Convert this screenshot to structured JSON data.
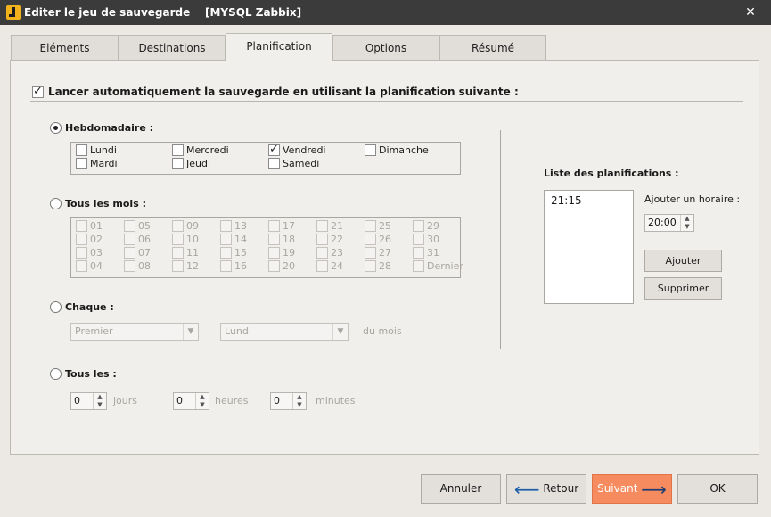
{
  "window": {
    "title": "Editer le jeu de sauvegarde    [MYSQL Zabbix]",
    "close_glyph": "✕"
  },
  "tabs": [
    {
      "label": "Eléments"
    },
    {
      "label": "Destinations"
    },
    {
      "label": "Planification"
    },
    {
      "label": "Options"
    },
    {
      "label": "Résumé"
    }
  ],
  "schedule": {
    "auto_label": "Lancer automatiquement la sauvegarde en utilisant la planification suivante :",
    "weekly": {
      "label": "Hebdomadaire :",
      "days": [
        {
          "label": "Lundi",
          "checked": false
        },
        {
          "label": "Mercredi",
          "checked": false
        },
        {
          "label": "Vendredi",
          "checked": true
        },
        {
          "label": "Dimanche",
          "checked": false
        },
        {
          "label": "Mardi",
          "checked": false
        },
        {
          "label": "Jeudi",
          "checked": false
        },
        {
          "label": "Samedi",
          "checked": false
        }
      ]
    },
    "monthly": {
      "label": "Tous les mois :",
      "days": [
        "01",
        "05",
        "09",
        "13",
        "17",
        "21",
        "25",
        "29",
        "02",
        "06",
        "10",
        "14",
        "18",
        "22",
        "26",
        "30",
        "03",
        "07",
        "11",
        "15",
        "19",
        "23",
        "27",
        "31",
        "04",
        "08",
        "12",
        "16",
        "20",
        "24",
        "28",
        "Dernier"
      ]
    },
    "each": {
      "label": "Chaque :",
      "first_select": "Premier",
      "second_select": "Lundi",
      "suffix": "du mois"
    },
    "every": {
      "label": "Tous les :",
      "days_value": "0",
      "days_label": "jours",
      "hours_value": "0",
      "hours_label": "heures",
      "minutes_value": "0",
      "minutes_label": "minutes"
    },
    "list": {
      "label": "Liste des planifications :",
      "items": [
        "21:15"
      ],
      "add_time_label": "Ajouter un horaire :",
      "time_value": "20:00",
      "add_button": "Ajouter",
      "remove_button": "Supprimer"
    }
  },
  "footer": {
    "cancel": "Annuler",
    "back": "Retour",
    "next": "Suivant",
    "ok": "OK",
    "back_icon": "arrow-left-icon",
    "next_icon": "arrow-right-icon",
    "accent_color": "#f58b5e"
  }
}
